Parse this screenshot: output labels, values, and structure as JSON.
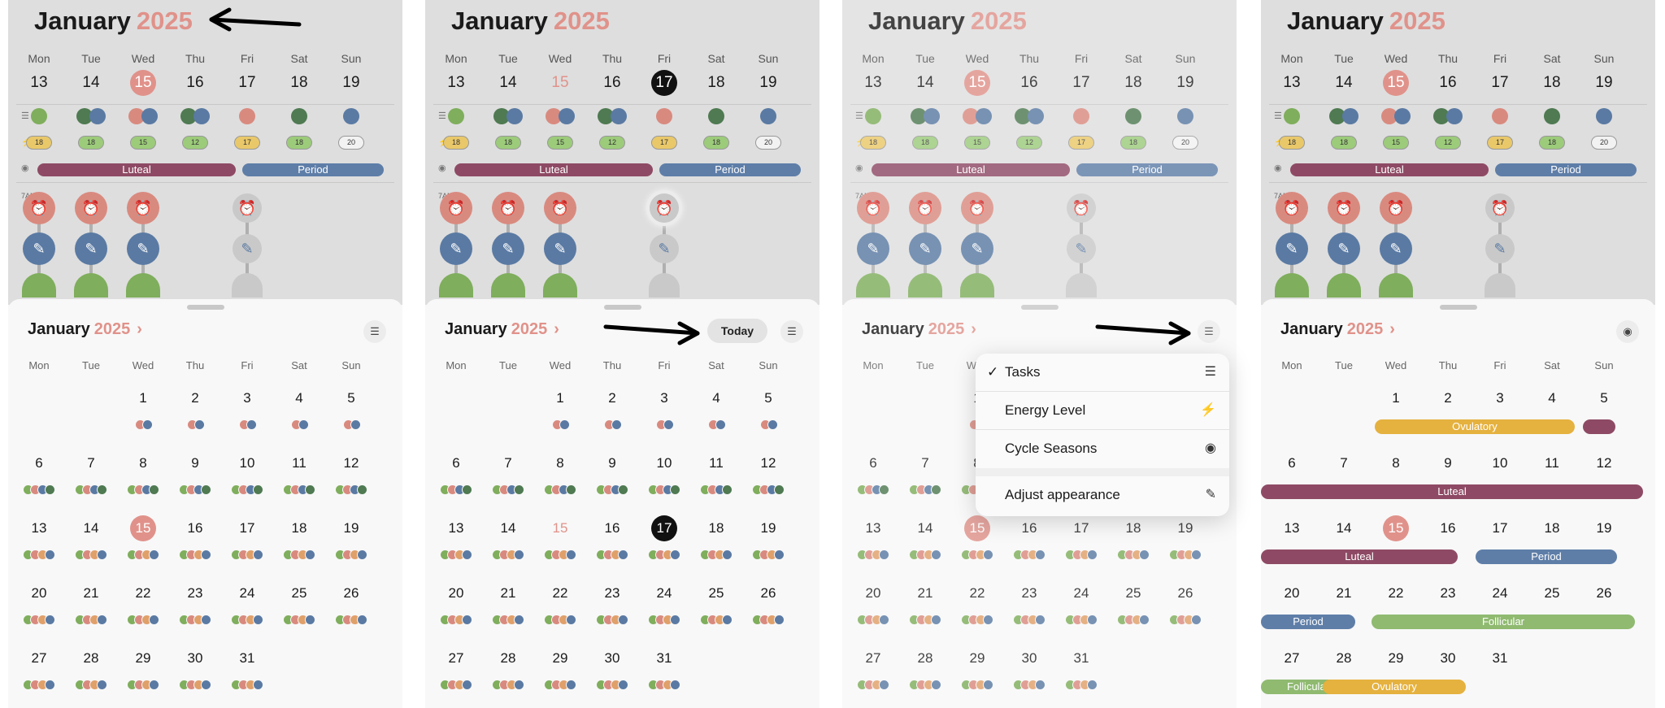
{
  "month": "January",
  "year": "2025",
  "week": {
    "weekdays": [
      "Mon",
      "Tue",
      "Wed",
      "Thu",
      "Fri",
      "Sat",
      "Sun"
    ],
    "days": [
      "13",
      "14",
      "15",
      "16",
      "17",
      "18",
      "19"
    ],
    "time_label": "7AM",
    "energy_values": [
      "18",
      "18",
      "15",
      "12",
      "17",
      "18",
      "20"
    ]
  },
  "seasons": {
    "luteal": "Luteal",
    "period": "Period",
    "ovulatory": "Ovulatory",
    "follicular": "Follicular"
  },
  "month_view": {
    "weekdays": [
      "Mon",
      "Tue",
      "Wed",
      "Thu",
      "Fri",
      "Sat",
      "Sun"
    ],
    "rows": [
      [
        "",
        "",
        "1",
        "2",
        "3",
        "4",
        "5"
      ],
      [
        "6",
        "7",
        "8",
        "9",
        "10",
        "11",
        "12"
      ],
      [
        "13",
        "14",
        "15",
        "16",
        "17",
        "18",
        "19"
      ],
      [
        "20",
        "21",
        "22",
        "23",
        "24",
        "25",
        "26"
      ],
      [
        "27",
        "28",
        "29",
        "30",
        "31",
        "",
        ""
      ]
    ]
  },
  "today_button": "Today",
  "menu": {
    "items": [
      {
        "label": "Tasks",
        "checked": true,
        "icon": "list-icon"
      },
      {
        "label": "Energy Level",
        "checked": false,
        "icon": "bolt-icon"
      },
      {
        "label": "Cycle Seasons",
        "checked": false,
        "icon": "seasons-icon"
      }
    ],
    "adjust": {
      "label": "Adjust appearance",
      "icon": "brush-icon"
    }
  },
  "colors": {
    "accent": "#e0928a",
    "luteal": "#8e4a64",
    "period": "#5e7ea8",
    "ovulatory": "#e5b13f",
    "follicular": "#8fba70",
    "green": "#7fae5c",
    "blue": "#5a7aa3"
  }
}
